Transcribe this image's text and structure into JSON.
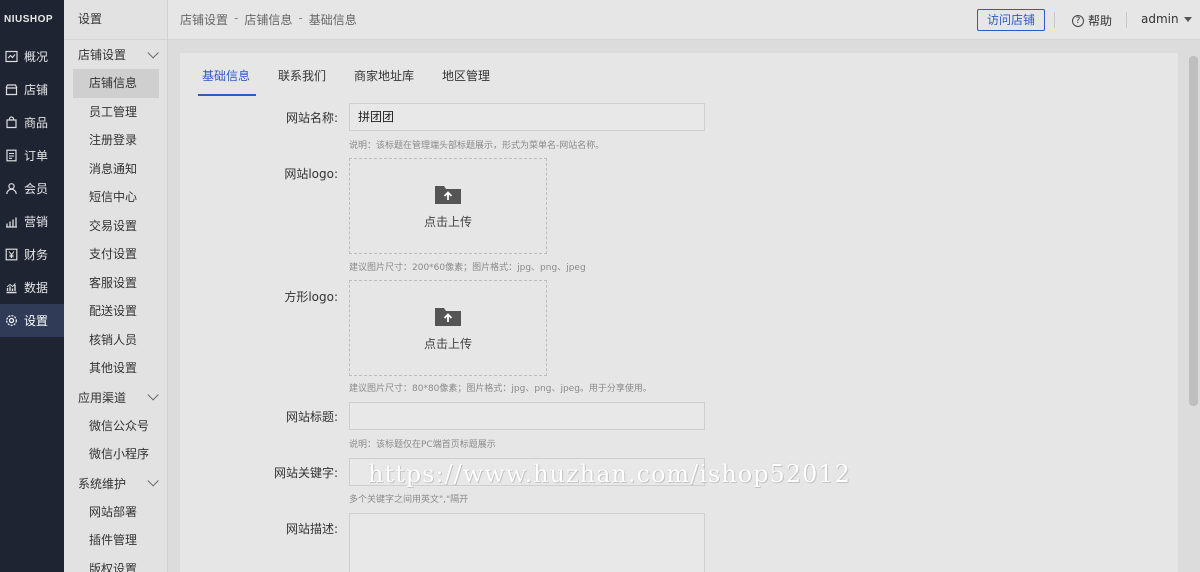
{
  "brand": "NIUSHOP",
  "nav": [
    {
      "label": "概况",
      "icon": "overview-icon"
    },
    {
      "label": "店铺",
      "icon": "store-icon"
    },
    {
      "label": "商品",
      "icon": "goods-icon"
    },
    {
      "label": "订单",
      "icon": "order-icon"
    },
    {
      "label": "会员",
      "icon": "member-icon"
    },
    {
      "label": "营销",
      "icon": "marketing-icon"
    },
    {
      "label": "财务",
      "icon": "finance-icon"
    },
    {
      "label": "数据",
      "icon": "data-icon"
    },
    {
      "label": "设置",
      "icon": "settings-icon"
    }
  ],
  "sidebar": {
    "title": "设置",
    "groups": [
      {
        "label": "店铺设置",
        "items": [
          "店铺信息",
          "员工管理",
          "注册登录",
          "消息通知",
          "短信中心",
          "交易设置",
          "支付设置",
          "客服设置",
          "配送设置",
          "核销人员",
          "其他设置"
        ]
      },
      {
        "label": "应用渠道",
        "items": [
          "微信公众号",
          "微信小程序"
        ]
      },
      {
        "label": "系统维护",
        "items": [
          "网站部署",
          "插件管理",
          "版权设置"
        ]
      }
    ]
  },
  "breadcrumb": [
    "店铺设置",
    "店铺信息",
    "基础信息"
  ],
  "breadcrumb_sep": "-",
  "top": {
    "visit_label": "访问店铺",
    "help_label": "帮助",
    "help_icon_glyph": "?",
    "user": "admin"
  },
  "tabs": [
    "基础信息",
    "联系我们",
    "商家地址库",
    "地区管理"
  ],
  "form": {
    "site_name_label": "网站名称:",
    "site_name_value": "拼团团",
    "site_name_hint": "说明：该标题在管理端头部标题展示，形式为菜单名-网站名称。",
    "logo_label": "网站logo:",
    "upload_text": "点击上传",
    "logo_hint": "建议图片尺寸：200*60像素；图片格式：jpg、png、jpeg",
    "square_logo_label": "方形logo:",
    "square_logo_hint": "建议图片尺寸：80*80像素；图片格式：jpg、png、jpeg。用于分享使用。",
    "site_title_label": "网站标题:",
    "site_title_hint": "说明：该标题仅在PC端首页标题展示",
    "keywords_label": "网站关键字:",
    "keywords_hint": "多个关键字之间用英文\",\"隔开",
    "desc_label": "网站描述:"
  },
  "watermark": "https://www.huzhan.com/ishop52012",
  "colors": {
    "nav_bg": "#1f2433",
    "accent": "#2e5ac8"
  }
}
